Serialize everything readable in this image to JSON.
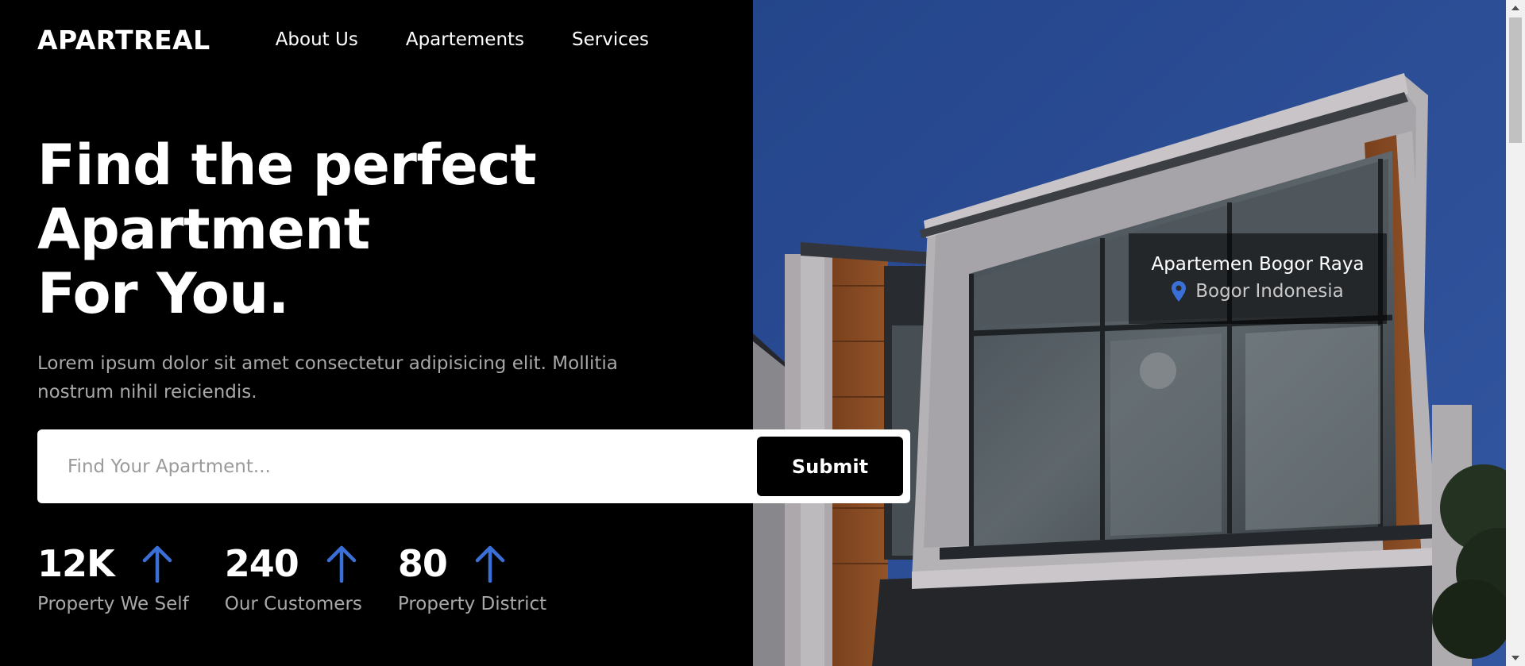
{
  "brand": {
    "logo": "APARTREAL"
  },
  "nav": {
    "items": [
      {
        "label": "About Us"
      },
      {
        "label": "Apartements"
      },
      {
        "label": "Services"
      }
    ]
  },
  "hero": {
    "title_lines": [
      "Find the perfect",
      "Apartment",
      "For You."
    ],
    "description": "Lorem ipsum dolor sit amet consectetur adipisicing elit. Mollitia nostrum nihil reiciendis."
  },
  "search": {
    "placeholder": "Find Your Apartment...",
    "value": "",
    "submit_label": "Submit"
  },
  "stats": [
    {
      "value": "12K",
      "label": "Property We Self",
      "icon": "arrow-up-icon"
    },
    {
      "value": "240",
      "label": "Our Customers",
      "icon": "arrow-up-icon"
    },
    {
      "value": "80",
      "label": "Property District",
      "icon": "arrow-up-icon"
    }
  ],
  "location_card": {
    "name": "Apartemen Bogor Raya",
    "city": "Bogor Indonesia",
    "icon": "map-pin-icon"
  },
  "colors": {
    "background": "#000000",
    "accent": "#3a6fd8",
    "text_muted": "#a8a8a8",
    "sky": "#2f55a4"
  }
}
